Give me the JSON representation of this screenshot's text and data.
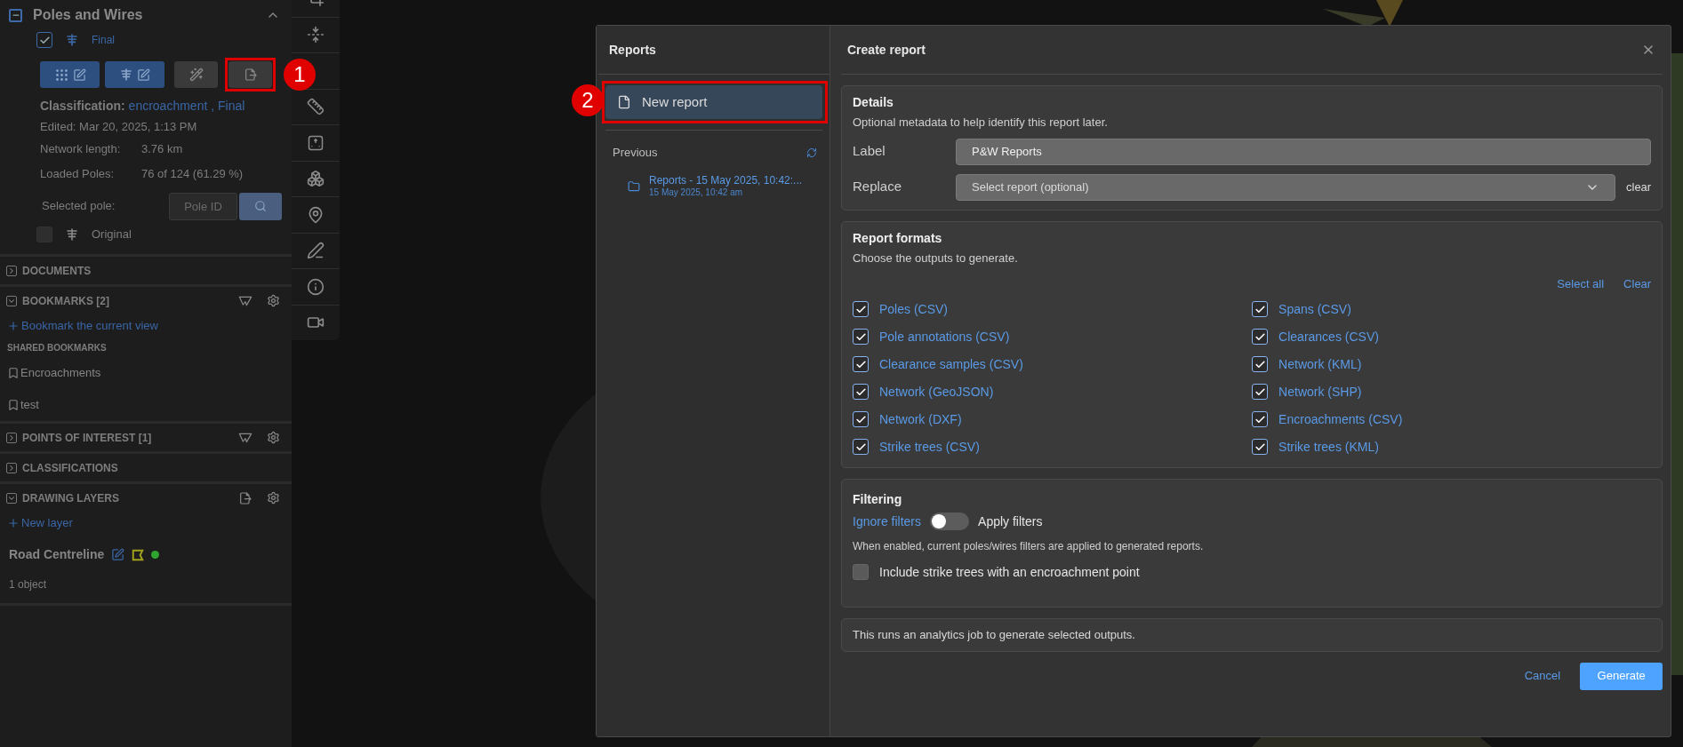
{
  "layers_panel": {
    "title": "Poles and Wires",
    "expanded": true,
    "final": {
      "label": "Final",
      "checked": true
    },
    "tool_buttons": [
      {
        "kind": "points-edit"
      },
      {
        "kind": "poles-edit"
      },
      {
        "kind": "magic"
      },
      {
        "kind": "export",
        "annotation": "1"
      }
    ],
    "classification": {
      "label": "Classification:",
      "values": [
        "encroachment",
        "Final"
      ],
      "separator": ","
    },
    "edited": "Edited: Mar 20, 2025, 1:13 PM",
    "stats": [
      {
        "label": "Network length:",
        "value": "3.76 km"
      },
      {
        "label": "Loaded Poles:",
        "value": "76 of 124 (61.29 %)"
      }
    ],
    "selected_pole": {
      "label": "Selected pole:",
      "placeholder": "Pole ID"
    },
    "original": {
      "label": "Original",
      "checked": false
    }
  },
  "sections": [
    {
      "title": "DOCUMENTS",
      "expanded": false
    },
    {
      "title": "BOOKMARKS [2]",
      "expanded": true,
      "tools": [
        {
          "kind": "filter"
        },
        {
          "kind": "settings"
        }
      ],
      "add_link": "Bookmark the current view",
      "subheading": "SHARED BOOKMARKS",
      "items": [
        "Encroachments",
        "test"
      ]
    },
    {
      "title": "POINTS OF INTEREST [1]",
      "expanded": false,
      "tools": [
        {
          "kind": "filter"
        },
        {
          "kind": "settings"
        }
      ]
    },
    {
      "title": "CLASSIFICATIONS",
      "expanded": false
    },
    {
      "title": "DRAWING LAYERS",
      "expanded": true,
      "tools": [
        {
          "kind": "export"
        },
        {
          "kind": "settings"
        }
      ],
      "add_link": "New layer",
      "layers": [
        {
          "name": "Road Centreline",
          "color": "#2fa52f",
          "count": "1 object"
        }
      ]
    }
  ],
  "dialog": {
    "sidebar": {
      "title": "Reports",
      "new_report": {
        "label": "New report",
        "selected": true,
        "annotation": "2"
      },
      "previous_label": "Previous",
      "previous": [
        {
          "title": "Reports - 15 May 2025, 10:42:...",
          "subtitle": "15 May 2025, 10:42 am"
        }
      ]
    },
    "title": "Create report",
    "details": {
      "title": "Details",
      "description": "Optional metadata to help identify this report later.",
      "label_field": {
        "label": "Label",
        "value": "P&W Reports"
      },
      "replace_field": {
        "label": "Replace",
        "placeholder": "Select report (optional)",
        "clear": "clear"
      }
    },
    "formats": {
      "title": "Report formats",
      "description": "Choose the outputs to generate.",
      "select_all": "Select all",
      "clear": "Clear",
      "options": [
        {
          "label": "Poles (CSV)",
          "checked": true
        },
        {
          "label": "Spans (CSV)",
          "checked": true
        },
        {
          "label": "Pole annotations (CSV)",
          "checked": true
        },
        {
          "label": "Clearances (CSV)",
          "checked": true
        },
        {
          "label": "Clearance samples (CSV)",
          "checked": true
        },
        {
          "label": "Network (KML)",
          "checked": true
        },
        {
          "label": "Network (GeoJSON)",
          "checked": true
        },
        {
          "label": "Network (SHP)",
          "checked": true
        },
        {
          "label": "Network (DXF)",
          "checked": true
        },
        {
          "label": "Encroachments (CSV)",
          "checked": true
        },
        {
          "label": "Strike trees (CSV)",
          "checked": true
        },
        {
          "label": "Strike trees (KML)",
          "checked": true
        }
      ]
    },
    "filtering": {
      "title": "Filtering",
      "off_label": "Ignore filters",
      "on_label": "Apply filters",
      "on": false,
      "note": "When enabled, current poles/wires filters are applied to generated reports.",
      "include": {
        "label": "Include strike trees with an encroachment point",
        "checked": false
      }
    },
    "info": "This runs an analytics job to generate selected outputs.",
    "cancel": "Cancel",
    "generate": "Generate"
  }
}
